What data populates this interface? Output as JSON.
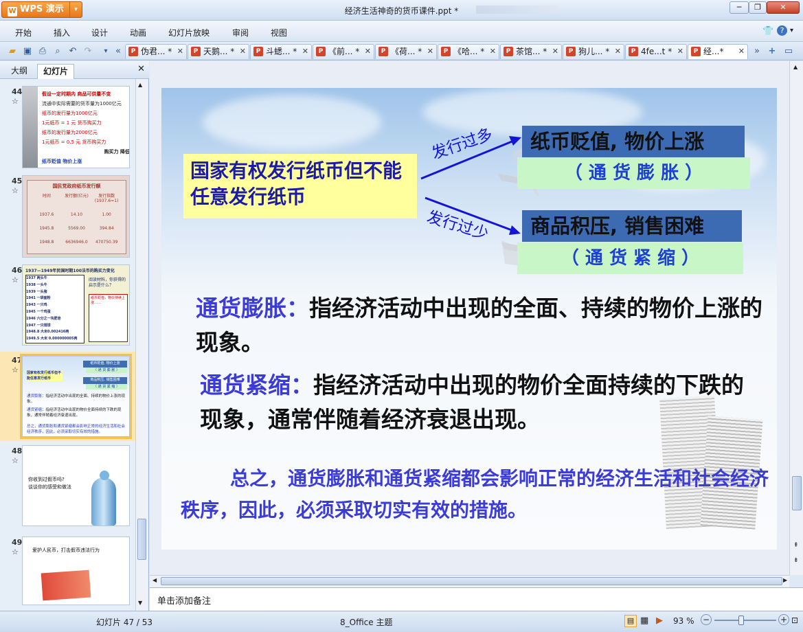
{
  "app": {
    "name": "WPS 演示",
    "document_title": "经济生活神奇的货币课件.ppt *"
  },
  "menu": [
    "开始",
    "插入",
    "设计",
    "动画",
    "幻灯片放映",
    "审阅",
    "视图"
  ],
  "tabs": [
    {
      "label": "伪君... *"
    },
    {
      "label": "天鹅... *"
    },
    {
      "label": "斗蟋... *"
    },
    {
      "label": "《前... *"
    },
    {
      "label": "《荷... *"
    },
    {
      "label": "《哈... *"
    },
    {
      "label": "茶馆... *"
    },
    {
      "label": "狗儿... *"
    },
    {
      "label": "4fe...t *"
    },
    {
      "label": "经...*"
    }
  ],
  "panel": {
    "tab_outline": "大纲",
    "tab_slides": "幻灯片"
  },
  "thumbnails": [
    {
      "num": "44",
      "star": "☆",
      "lines": [
        "假设一定时期内 商品可供量不变",
        "流通中实际需要的货币量为1000亿元",
        "纸币的发行量为1000亿元",
        "1元纸币 = 1 元 货币购买力",
        "纸币的发行量为2000亿元",
        "1元纸币 = 0.5 元 货币购买力",
        "购买力 降低",
        "纸币贬值 物价上涨"
      ]
    },
    {
      "num": "45",
      "star": "☆",
      "title": "国民党政府纸币发行额",
      "headers": [
        "时间",
        "发行额(亿元)",
        "发行指数(1937.6=1)"
      ],
      "rows": [
        [
          "1937.6",
          "14.10",
          "1.00"
        ],
        [
          "1945.8",
          "5569.00",
          "394.84"
        ],
        [
          "1948.8",
          "6636946.0",
          "470750.39"
        ]
      ]
    },
    {
      "num": "46",
      "star": "☆",
      "title": "1937—1949年民国时期100法币的购买力变化",
      "lines": [
        "1937 两头牛",
        "1938 一头牛",
        "1939 一头猪",
        "1941 一袋面粉",
        "1943 一只鸡",
        "1945 一个鸡蛋",
        "1946 六分之一块肥皂",
        "1947 一只煤球",
        "1948.8 大米0.002416两",
        "1949.5 大米 0.000000005两"
      ],
      "side": "阅读材料，你获得的启示是什么？"
    },
    {
      "num": "47",
      "star": "☆"
    },
    {
      "num": "48",
      "star": "☆",
      "lines": [
        "你收到过假币吗?",
        "谈谈你的感受和做法"
      ]
    },
    {
      "num": "49",
      "star": "☆",
      "lines": [
        "爱护人民币，打击假币违法行为"
      ]
    }
  ],
  "slide": {
    "left_box": "国家有权发行纸币但不能任意发行纸币",
    "arrow_up_label": "发行过多",
    "arrow_down_label": "发行过少",
    "box1_title": "纸币贬值, 物价上涨",
    "box1_sub": "（ 通  货  膨  胀 ）",
    "box2_title": "商品积压, 销售困难",
    "box2_sub": "（ 通  货  紧  缩 ）",
    "inflation_term": "通货膨胀：",
    "inflation_def": "指经济活动中出现的全面、持续的物价上涨的现象。",
    "deflation_term": "通货紧缩：",
    "deflation_def": "指经济活动中出现的物价全面持续的下跌的现象，通常伴随着经济衰退出现。",
    "summary": "总之，通货膨胀和通货紧缩都会影响正常的经济生活和社会经济秩序，因此，必须采取切实有效的措施。"
  },
  "notes_placeholder": "单击添加备注",
  "status": {
    "slide_counter": "幻灯片 47 / 53",
    "theme": "8_Office 主题",
    "zoom": "93 %"
  }
}
